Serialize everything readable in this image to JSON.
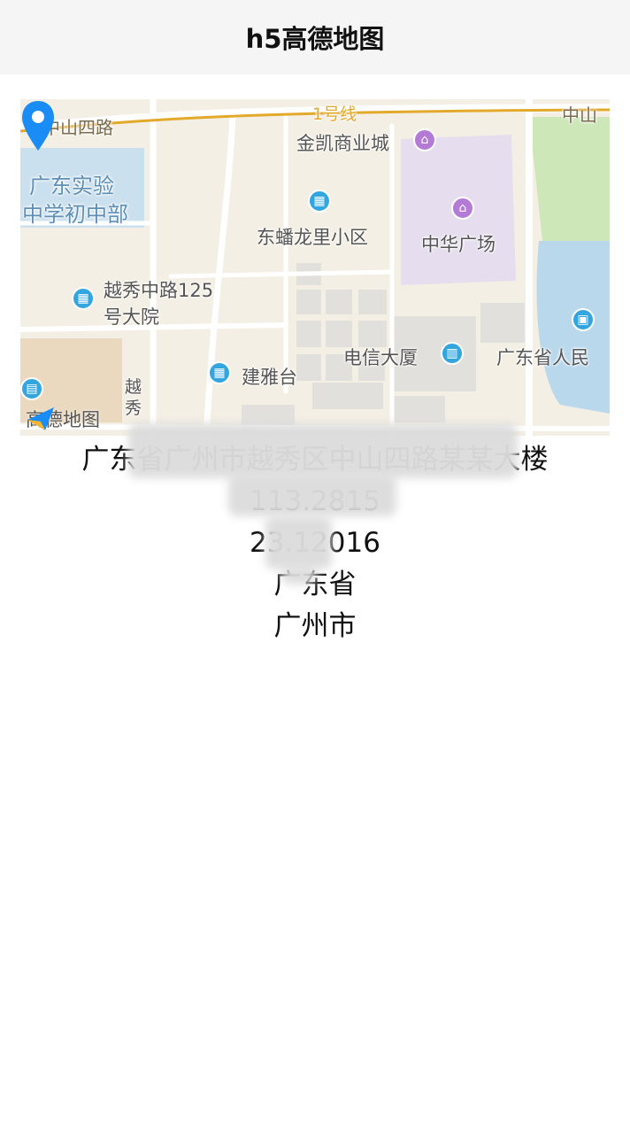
{
  "header": {
    "title": "h5高德地图"
  },
  "map": {
    "logo": "高德地图",
    "labels": {
      "zhongshan_road": "中山四路",
      "line1": "1号线",
      "zhongshan_right": "中山",
      "jinkai": "金凯商业城",
      "guangdong_school_1": "广东实验",
      "guangdong_school_2": "中学初中部",
      "dongrong": "东蟠龙里小区",
      "zhonghua": "中华广场",
      "yuexiu_1": "越秀中路125",
      "yuexiu_2": "号大院",
      "dianxin": "电信大厦",
      "gov": "广东省人民",
      "jianya": "建雅台",
      "yue": "越",
      "xiu": "秀"
    }
  },
  "info": {
    "address": "广东省广州市越秀区中山四路某某大楼",
    "line2": "113.2815",
    "line3": "23.12016",
    "province": "广东省",
    "city": "广州市"
  }
}
